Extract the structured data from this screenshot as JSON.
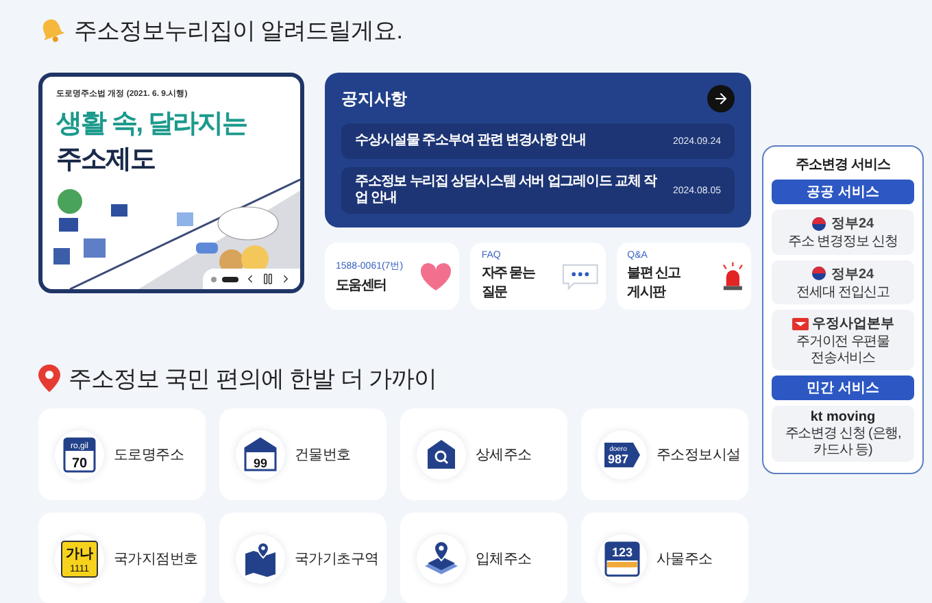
{
  "header": {
    "title": "주소정보누리집이 알려드릴게요."
  },
  "banner": {
    "caption": "도로명주소법 개정 (2021. 6. 9.시행)",
    "headline": "생활 속, 달라지는",
    "headline_2": "주소제도",
    "slides": [
      {
        "selected": false
      },
      {
        "selected": true
      }
    ]
  },
  "notices": {
    "title": "공지사항",
    "items": [
      {
        "title": "수상시설물 주소부여 관련 변경사항 안내",
        "date": "2024.09.24"
      },
      {
        "title": "주소정보 누리집 상담시스템 서버 업그레이드 교체 작업 안내",
        "date": "2024.08.05"
      }
    ]
  },
  "quick_links": [
    {
      "kind": "heart",
      "caption": "1588-0061(7번)",
      "label": "도움센터"
    },
    {
      "kind": "chat",
      "caption": "FAQ",
      "label": "자주 묻는 질문"
    },
    {
      "kind": "siren",
      "caption": "Q&A",
      "label": "불편 신고 게시판"
    }
  ],
  "side_widget": {
    "title": "주소변경 서비스",
    "sections": [
      {
        "heading": "공공 서비스",
        "items": [
          {
            "kind": "gov24",
            "brand": "정부24",
            "label": "주소 변경정보 신청"
          },
          {
            "kind": "gov24",
            "brand": "정부24",
            "label": "전세대 전입신고"
          },
          {
            "kind": "post",
            "brand": "우정사업본부",
            "label": "주거이전 우편물 전송서비스"
          }
        ]
      },
      {
        "heading": "민간 서비스",
        "items": [
          {
            "kind": "kt",
            "brand": "kt moving",
            "label": "주소변경 신청 (은행,카드사 등)"
          }
        ]
      }
    ]
  },
  "section": {
    "title": "주소정보 국민 편의에 한발 더 가까이"
  },
  "services": [
    {
      "kind": "road_sign",
      "label": "도로명주소",
      "sign_top": "ro,gil",
      "sign_text": "70"
    },
    {
      "kind": "building_number",
      "label": "건물번호",
      "sign_text": "99"
    },
    {
      "kind": "detail",
      "label": "상세주소"
    },
    {
      "kind": "facility",
      "label": "주소정보시설",
      "sign_top": "doero",
      "sign_text": "987"
    },
    {
      "kind": "national_point",
      "label": "국가지점번호",
      "sign_top": "가나",
      "sign_text": "1111"
    },
    {
      "kind": "base_zone",
      "label": "국가기초구역"
    },
    {
      "kind": "solid",
      "label": "입체주소"
    },
    {
      "kind": "object",
      "label": "사물주소",
      "sign_text": "123"
    }
  ]
}
